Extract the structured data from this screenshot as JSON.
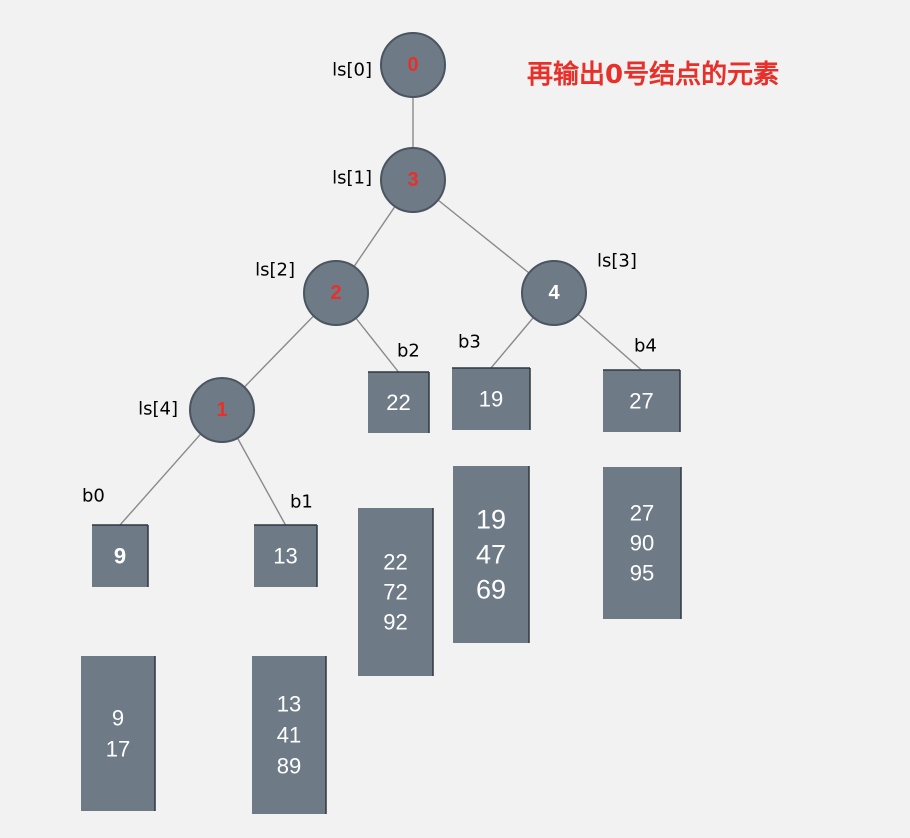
{
  "title": "再输出0号结点的元素",
  "colors": {
    "title": "#e8302a",
    "node_fill": "#6e7b87",
    "highlight_text": "#e8302a",
    "normal_text": "#ffffff",
    "edge": "#8a8a8a",
    "box_fill": "#6e7b87"
  },
  "nodes": [
    {
      "id": "n0",
      "value": "0",
      "label": "ls[0]",
      "highlight": true
    },
    {
      "id": "n1",
      "value": "3",
      "label": "ls[1]",
      "highlight": true
    },
    {
      "id": "n2",
      "value": "2",
      "label": "ls[2]",
      "highlight": true
    },
    {
      "id": "n3",
      "value": "4",
      "label": "ls[3]",
      "highlight": false
    },
    {
      "id": "n4",
      "value": "1",
      "label": "ls[4]",
      "highlight": true
    }
  ],
  "leaves": [
    {
      "id": "b0",
      "label": "b0",
      "value": "9",
      "highlight": true
    },
    {
      "id": "b1",
      "label": "b1",
      "value": "13",
      "highlight": false
    },
    {
      "id": "b2",
      "label": "b2",
      "value": "22",
      "highlight": false
    },
    {
      "id": "b3",
      "label": "b3",
      "value": "19",
      "highlight": false
    },
    {
      "id": "b4",
      "label": "b4",
      "value": "27",
      "highlight": false
    }
  ],
  "buffers": [
    {
      "id": "buf-b0",
      "values": [
        "9",
        "17"
      ]
    },
    {
      "id": "buf-b1",
      "values": [
        "13",
        "41",
        "89"
      ]
    },
    {
      "id": "buf-b2",
      "values": [
        "22",
        "72",
        "92"
      ]
    },
    {
      "id": "buf-b3",
      "values": [
        "19",
        "47",
        "69"
      ]
    },
    {
      "id": "buf-b4",
      "values": [
        "27",
        "90",
        "95"
      ]
    }
  ],
  "edges": [
    [
      "n0",
      "n1"
    ],
    [
      "n1",
      "n2"
    ],
    [
      "n1",
      "n3"
    ],
    [
      "n2",
      "n4"
    ],
    [
      "n2",
      "b2"
    ],
    [
      "n3",
      "b3"
    ],
    [
      "n3",
      "b4"
    ],
    [
      "n4",
      "b0"
    ],
    [
      "n4",
      "b1"
    ]
  ]
}
